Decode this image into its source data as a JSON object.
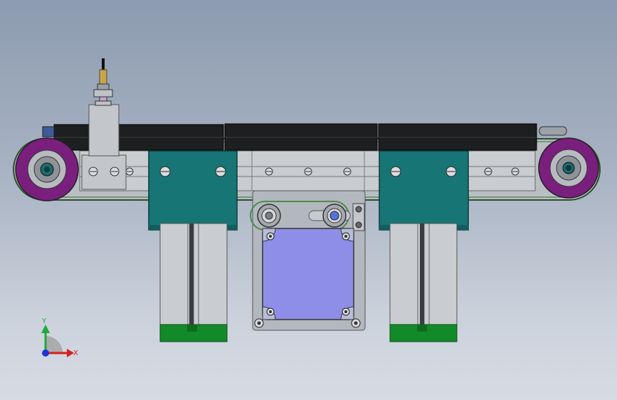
{
  "triad": {
    "y_label": "Y",
    "x_label": "X",
    "y_color": "#1faa3a",
    "x_color": "#d42020",
    "z_color": "#2033d4"
  },
  "colors": {
    "belt": "#1e1f21",
    "frame": "#c9ccd0",
    "teal_block": "#177575",
    "pulley_purple": "#7a1f7e",
    "motor_plate": "#8e8ee8",
    "cylinder_cap": "#138a2a"
  }
}
